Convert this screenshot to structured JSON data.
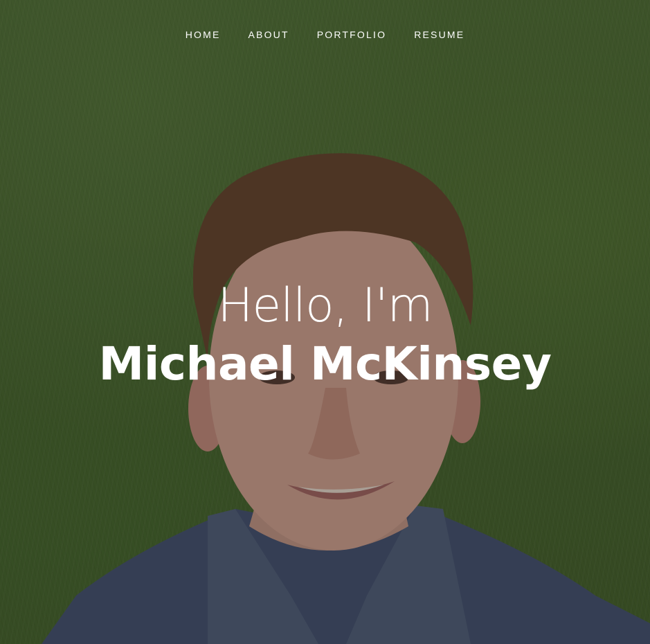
{
  "nav": {
    "items": [
      {
        "label": "HOME"
      },
      {
        "label": "ABOUT"
      },
      {
        "label": "PORTFOLIO"
      },
      {
        "label": "RESUME"
      }
    ]
  },
  "hero": {
    "greeting": "Hello, I'm",
    "name": "Michael McKinsey"
  }
}
